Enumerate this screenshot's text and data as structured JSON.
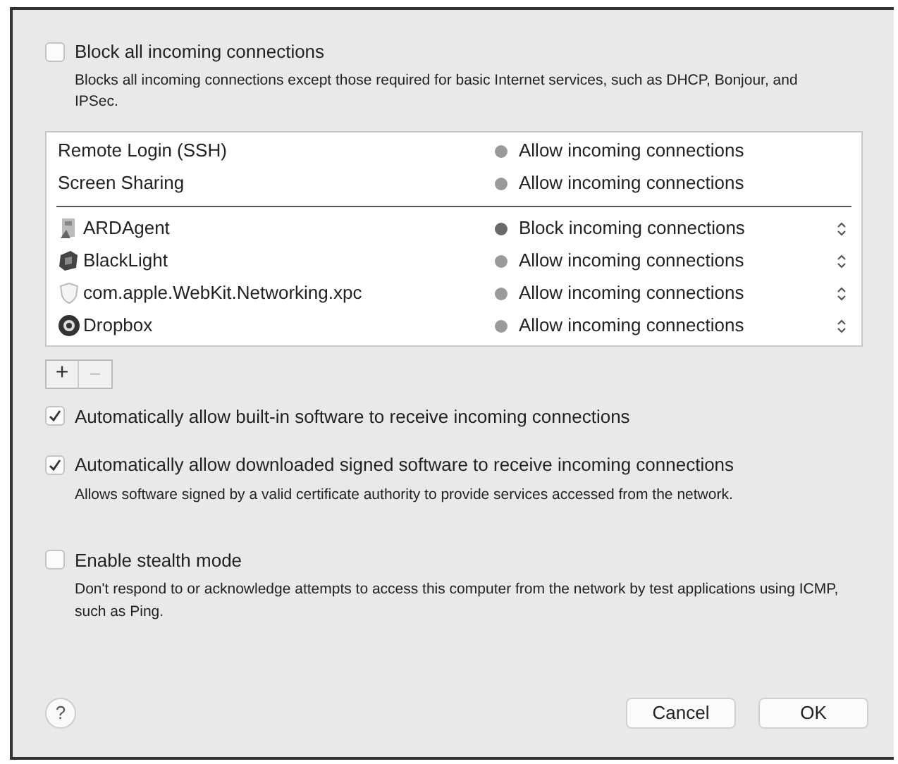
{
  "block_all": {
    "label": "Block all incoming connections",
    "checked": false,
    "description": "Blocks all incoming connections except those required for basic Internet services, such as DHCP, Bonjour, and IPSec."
  },
  "rows": [
    {
      "kind": "service",
      "name": "Remote Login (SSH)",
      "status": "Allow incoming connections",
      "color": "#9a9a9a"
    },
    {
      "kind": "service",
      "name": "Screen Sharing",
      "status": "Allow incoming connections",
      "color": "#9a9a9a"
    },
    {
      "kind": "app",
      "name": "ARDAgent",
      "status": "Block incoming connections",
      "color": "#6a6a6a"
    },
    {
      "kind": "app",
      "name": "BlackLight",
      "status": "Allow incoming connections",
      "color": "#9a9a9a"
    },
    {
      "kind": "app",
      "name": "com.apple.WebKit.Networking.xpc",
      "status": "Allow incoming connections",
      "color": "#9a9a9a"
    },
    {
      "kind": "app",
      "name": "Dropbox",
      "status": "Allow incoming connections",
      "color": "#9a9a9a"
    }
  ],
  "add_button": "+",
  "remove_button": "−",
  "options": [
    {
      "label": "Automatically allow built-in software to receive incoming connections",
      "checked": true
    },
    {
      "label": "Automatically allow downloaded signed software to receive incoming connections",
      "checked": true,
      "description": "Allows software signed by a valid certificate authority to provide services accessed from the network."
    },
    {
      "label": "Enable stealth mode",
      "checked": false,
      "description": "Don't respond to or acknowledge attempts to access this computer from the network by test applications using ICMP, such as Ping."
    }
  ],
  "help_button": "?",
  "buttons": [
    "Cancel",
    "OK"
  ]
}
